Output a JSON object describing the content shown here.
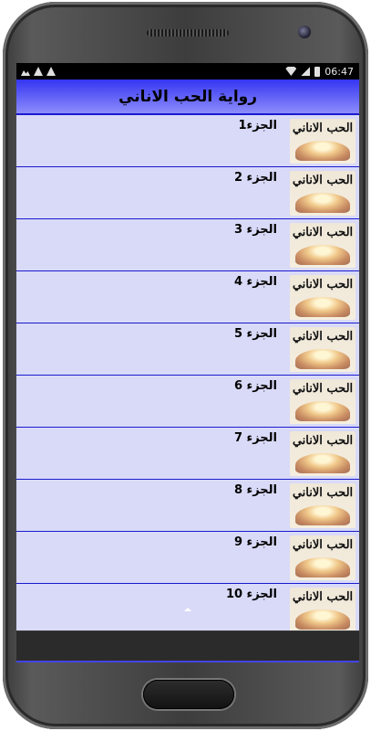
{
  "status_bar": {
    "time": "06:47",
    "left_icons": [
      "image-icon",
      "warning-icon",
      "warning-icon"
    ],
    "right_icons": [
      "wifi-icon",
      "signal-icon",
      "battery-icon"
    ]
  },
  "app": {
    "title": "رواية الحب الاناني"
  },
  "list": {
    "items": [
      {
        "label": "الجزء1",
        "thumb_text": "الحب الاناني"
      },
      {
        "label": "الجزء 2",
        "thumb_text": "الحب الاناني"
      },
      {
        "label": "الجزء 3",
        "thumb_text": "الحب الاناني"
      },
      {
        "label": "الجزء 4",
        "thumb_text": "الحب الاناني"
      },
      {
        "label": "الجزء 5",
        "thumb_text": "الحب الاناني"
      },
      {
        "label": "الجزء 6",
        "thumb_text": "الحب الاناني"
      },
      {
        "label": "الجزء 7",
        "thumb_text": "الحب الاناني"
      },
      {
        "label": "الجزء 8",
        "thumb_text": "الحب الاناني"
      },
      {
        "label": "الجزء 9",
        "thumb_text": "الحب الاناني"
      },
      {
        "label": "الجزء 10",
        "thumb_text": "الحب الاناني"
      }
    ]
  },
  "colors": {
    "title_bar_top": "#3535f2",
    "title_bar_bottom": "#8d8dfb",
    "list_bg": "#d9daf7",
    "divider": "#1b1bd0"
  }
}
